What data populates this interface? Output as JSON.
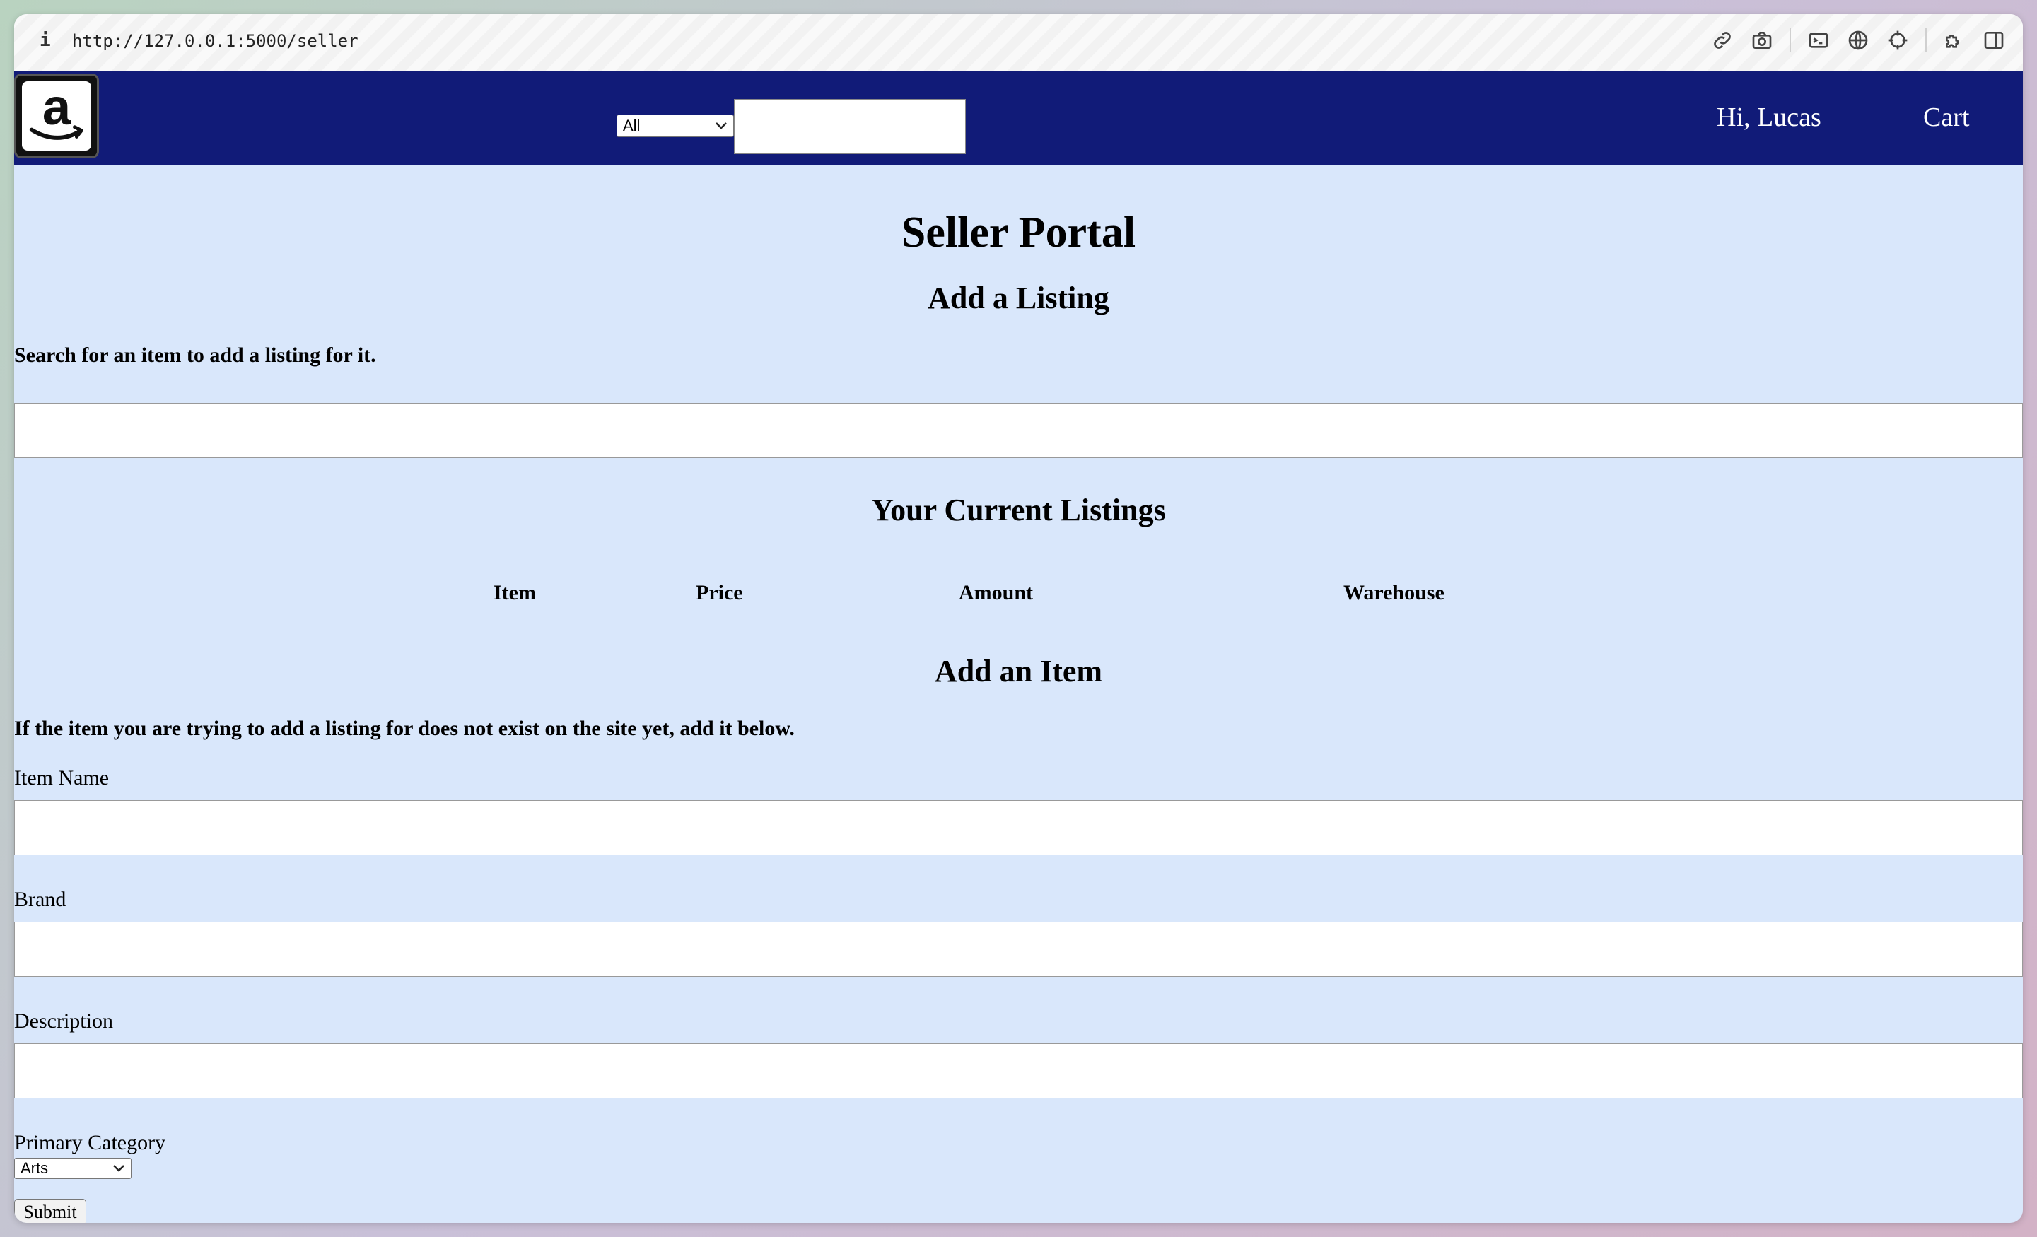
{
  "browser": {
    "info_glyph": "i",
    "url": "http://127.0.0.1:5000/seller"
  },
  "navbar": {
    "search_category": "All",
    "greeting": "Hi, Lucas",
    "cart_label": "Cart"
  },
  "page": {
    "title": "Seller Portal",
    "add_listing": {
      "heading": "Add a Listing",
      "instructions": "Search for an item to add a listing for it."
    },
    "current_listings": {
      "heading": "Your Current Listings",
      "columns": [
        "Item",
        "Price",
        "Amount",
        "Warehouse"
      ]
    },
    "add_item": {
      "heading": "Add an Item",
      "instructions": "If the item you are trying to add a listing for does not exist on the site yet, add it below.",
      "item_name_label": "Item Name",
      "brand_label": "Brand",
      "description_label": "Description",
      "category_label": "Primary Category",
      "category_value": "Arts",
      "submit_label": "Submit"
    }
  },
  "colors": {
    "navbar_bg": "#111b78",
    "page_bg": "#d9e7fb"
  }
}
